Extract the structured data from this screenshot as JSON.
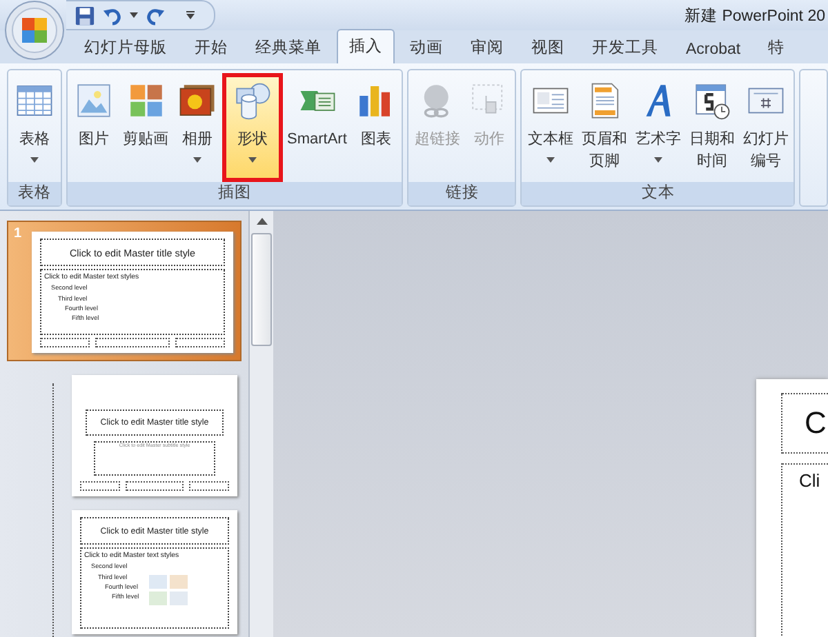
{
  "window": {
    "title": "新建 PowerPoint 20"
  },
  "tabs": [
    {
      "label": "幻灯片母版",
      "selected": false
    },
    {
      "label": "开始",
      "selected": false
    },
    {
      "label": "经典菜单",
      "selected": false
    },
    {
      "label": "插入",
      "selected": true
    },
    {
      "label": "动画",
      "selected": false
    },
    {
      "label": "审阅",
      "selected": false
    },
    {
      "label": "视图",
      "selected": false
    },
    {
      "label": "开发工具",
      "selected": false
    },
    {
      "label": "Acrobat",
      "selected": false
    },
    {
      "label": "特",
      "selected": false
    }
  ],
  "ribbon_groups": [
    {
      "label": "表格",
      "buttons": [
        {
          "label": [
            "表格"
          ],
          "dropdown": true,
          "disabled": false,
          "highlighted": false
        }
      ]
    },
    {
      "label": "插图",
      "buttons": [
        {
          "label": [
            "图片"
          ],
          "dropdown": false,
          "disabled": false,
          "highlighted": false
        },
        {
          "label": [
            "剪贴画"
          ],
          "dropdown": false,
          "disabled": false,
          "highlighted": false
        },
        {
          "label": [
            "相册"
          ],
          "dropdown": true,
          "disabled": false,
          "highlighted": false
        },
        {
          "label": [
            "形状"
          ],
          "dropdown": true,
          "disabled": false,
          "highlighted": true
        },
        {
          "label": [
            "SmartArt"
          ],
          "dropdown": false,
          "disabled": false,
          "highlighted": false
        },
        {
          "label": [
            "图表"
          ],
          "dropdown": false,
          "disabled": false,
          "highlighted": false
        }
      ]
    },
    {
      "label": "链接",
      "buttons": [
        {
          "label": [
            "超链接"
          ],
          "dropdown": false,
          "disabled": true,
          "highlighted": false
        },
        {
          "label": [
            "动作"
          ],
          "dropdown": false,
          "disabled": true,
          "highlighted": false
        }
      ]
    },
    {
      "label": "文本",
      "buttons": [
        {
          "label": [
            "文本框"
          ],
          "dropdown": true,
          "disabled": false,
          "highlighted": false
        },
        {
          "label": [
            "页眉和",
            "页脚"
          ],
          "dropdown": false,
          "disabled": false,
          "highlighted": false
        },
        {
          "label": [
            "艺术字"
          ],
          "dropdown": true,
          "disabled": false,
          "highlighted": false
        },
        {
          "label": [
            "日期和",
            "时间"
          ],
          "dropdown": false,
          "disabled": false,
          "highlighted": false
        },
        {
          "label": [
            "幻灯片",
            "编号"
          ],
          "dropdown": false,
          "disabled": false,
          "highlighted": false
        }
      ]
    }
  ],
  "slides": [
    {
      "number": "1",
      "selected": true,
      "kind": "content",
      "title": "Click to edit Master title style",
      "body": [
        {
          "text": "Click to edit Master text styles",
          "children": [
            {
              "text": "Second level",
              "children": [
                {
                  "text": "Third level",
                  "children": [
                    {
                      "text": "Fourth level",
                      "children": [
                        {
                          "text": "Fifth level"
                        }
                      ]
                    }
                  ]
                }
              ]
            }
          ]
        }
      ]
    },
    {
      "selected": false,
      "kind": "title",
      "title": "Click to edit Master title style",
      "subtitle": "Click to edit Master subtitle style"
    },
    {
      "selected": false,
      "kind": "content",
      "title": "Click to edit Master title style",
      "body": [
        {
          "text": "Click to edit Master text styles",
          "children": [
            {
              "text": "Second level",
              "children": [
                {
                  "text": "Third level",
                  "children": [
                    {
                      "text": "Fourth level",
                      "children": [
                        {
                          "text": "Fifth level"
                        }
                      ]
                    }
                  ]
                }
              ]
            }
          ]
        }
      ]
    }
  ],
  "editor_slide": {
    "title": "C",
    "body": [
      {
        "text": "Cli"
      }
    ]
  }
}
